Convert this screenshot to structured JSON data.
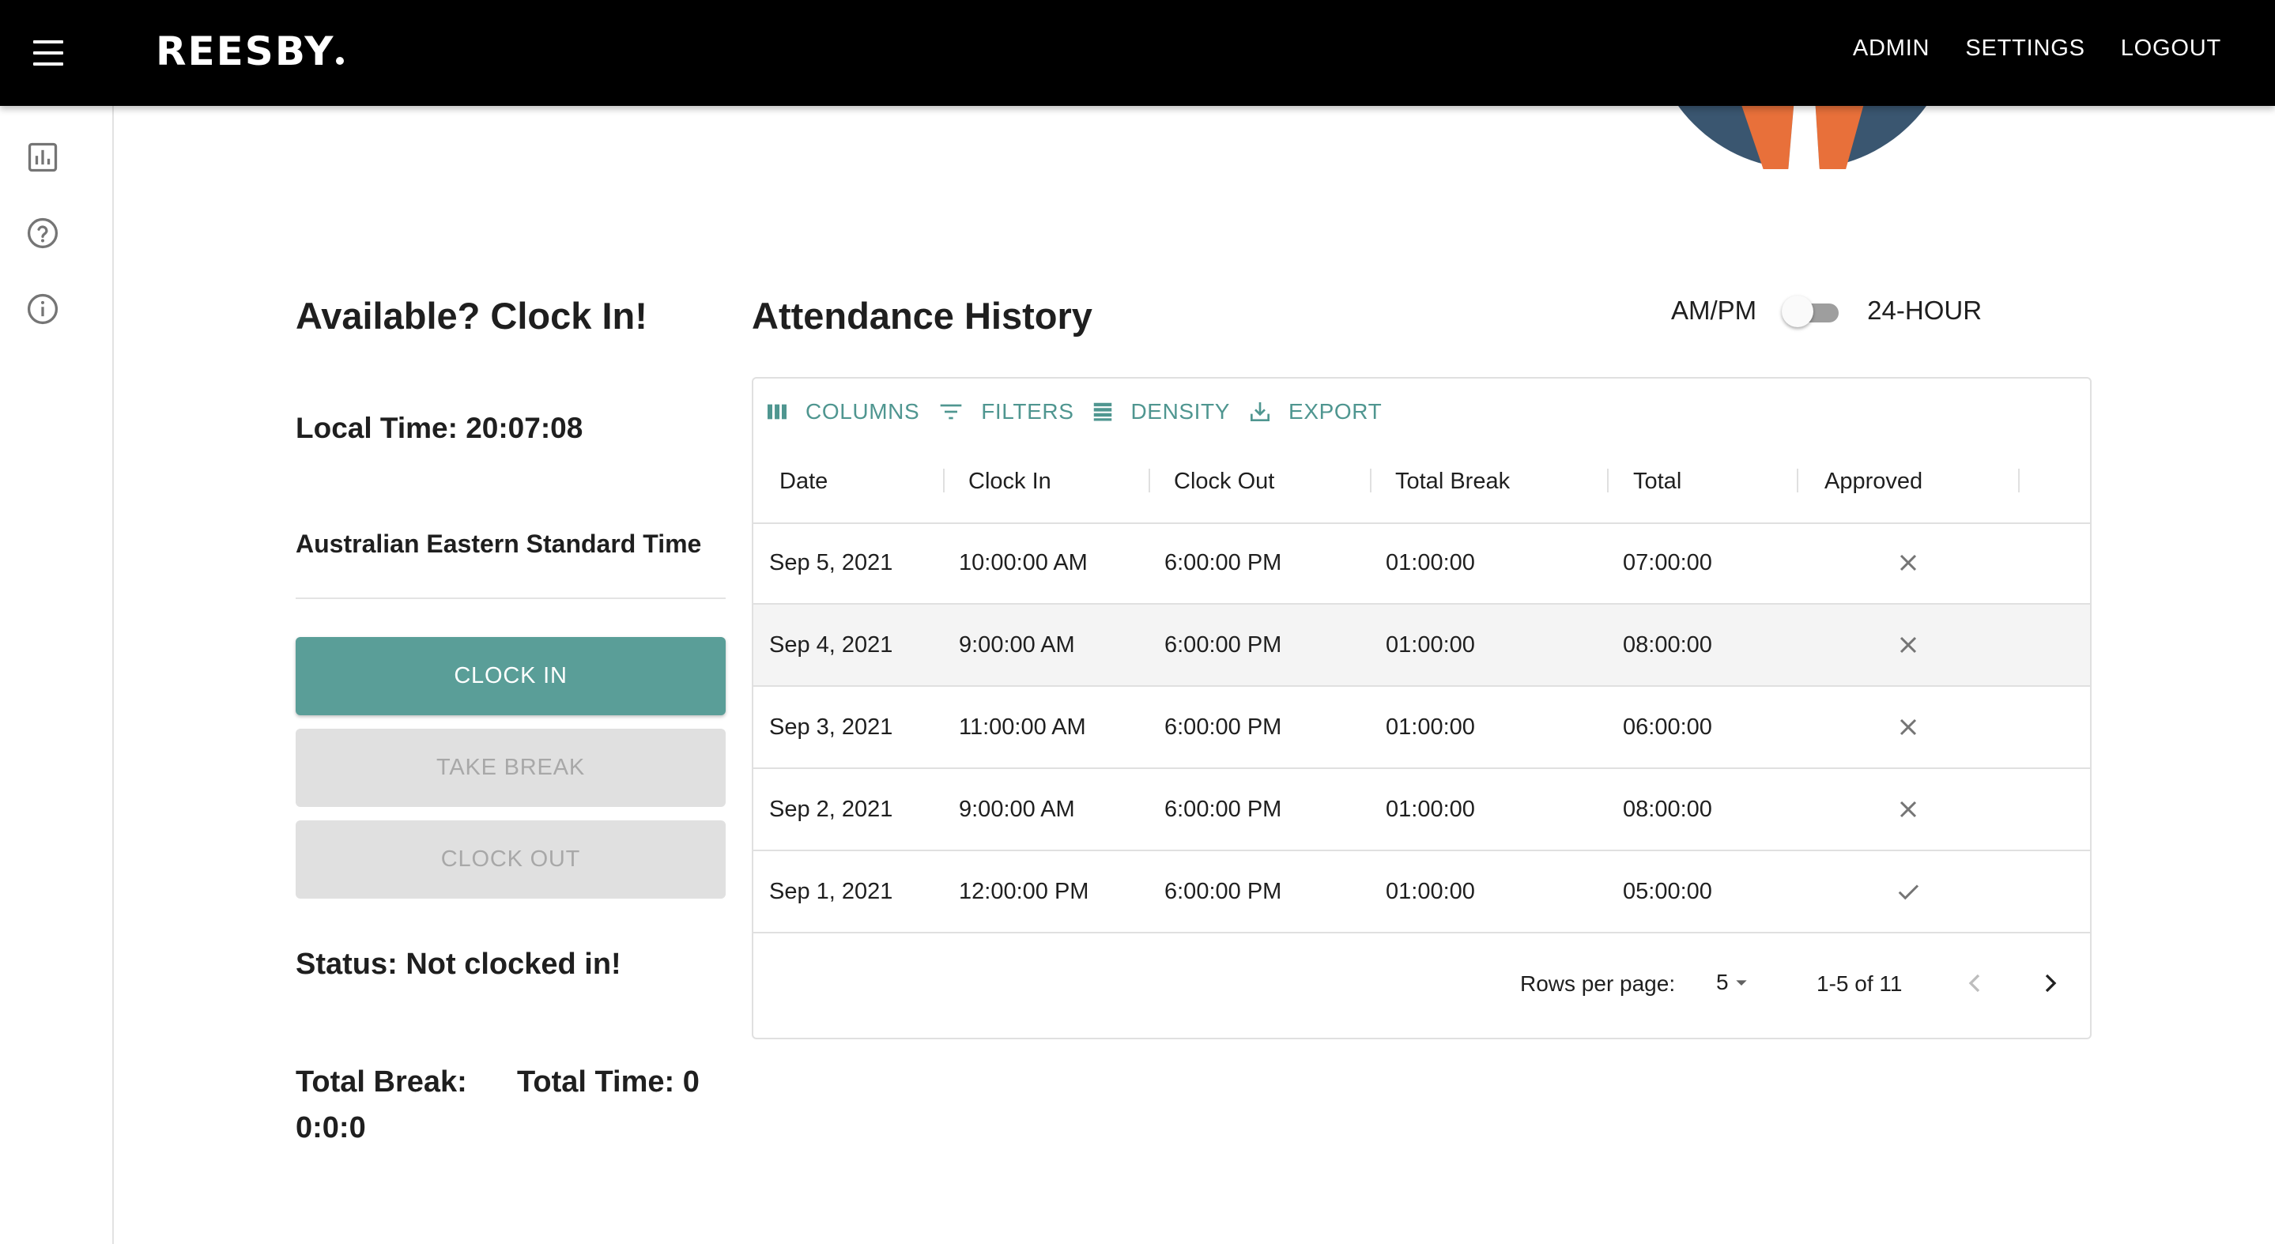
{
  "header": {
    "logo": "REESBY",
    "nav": [
      "ADMIN",
      "SETTINGS",
      "LOGOUT"
    ]
  },
  "sidebar": {
    "icons": [
      "chart-icon",
      "help-icon",
      "info-icon"
    ]
  },
  "clock": {
    "title": "Available? Clock In!",
    "local_time": "Local Time: 20:07:08",
    "timezone": "Australian Eastern Standard Time",
    "clock_in": "CLOCK IN",
    "take_break": "TAKE BREAK",
    "clock_out": "CLOCK OUT",
    "status": "Status: Not clocked in!",
    "total_break": "Total Break: 0:0:0",
    "total_time": "Total Time: 0"
  },
  "attendance": {
    "title": "Attendance History",
    "toggle_left": "AM/PM",
    "toggle_right": "24-HOUR",
    "toggle_on": false,
    "toolbar": [
      "COLUMNS",
      "FILTERS",
      "DENSITY",
      "EXPORT"
    ],
    "columns": [
      "Date",
      "Clock In",
      "Clock Out",
      "Total Break",
      "Total",
      "Approved"
    ],
    "rows": [
      {
        "date": "Sep 5, 2021",
        "clock_in": "10:00:00 AM",
        "clock_out": "6:00:00 PM",
        "total_break": "01:00:00",
        "total": "07:00:00",
        "approved": false
      },
      {
        "date": "Sep 4, 2021",
        "clock_in": "9:00:00 AM",
        "clock_out": "6:00:00 PM",
        "total_break": "01:00:00",
        "total": "08:00:00",
        "approved": false
      },
      {
        "date": "Sep 3, 2021",
        "clock_in": "11:00:00 AM",
        "clock_out": "6:00:00 PM",
        "total_break": "01:00:00",
        "total": "06:00:00",
        "approved": false
      },
      {
        "date": "Sep 2, 2021",
        "clock_in": "9:00:00 AM",
        "clock_out": "6:00:00 PM",
        "total_break": "01:00:00",
        "total": "08:00:00",
        "approved": false
      },
      {
        "date": "Sep 1, 2021",
        "clock_in": "12:00:00 PM",
        "clock_out": "6:00:00 PM",
        "total_break": "01:00:00",
        "total": "05:00:00",
        "approved": true
      }
    ],
    "rows_per_page_label": "Rows per page:",
    "rows_per_page": "5",
    "range": "1-5 of 11"
  },
  "colors": {
    "accent": "#5a9e98",
    "toolbar_text": "#4f9690",
    "header_bg": "#000000",
    "avatar_orange": "#e8703a",
    "avatar_navy": "#3a5670"
  }
}
